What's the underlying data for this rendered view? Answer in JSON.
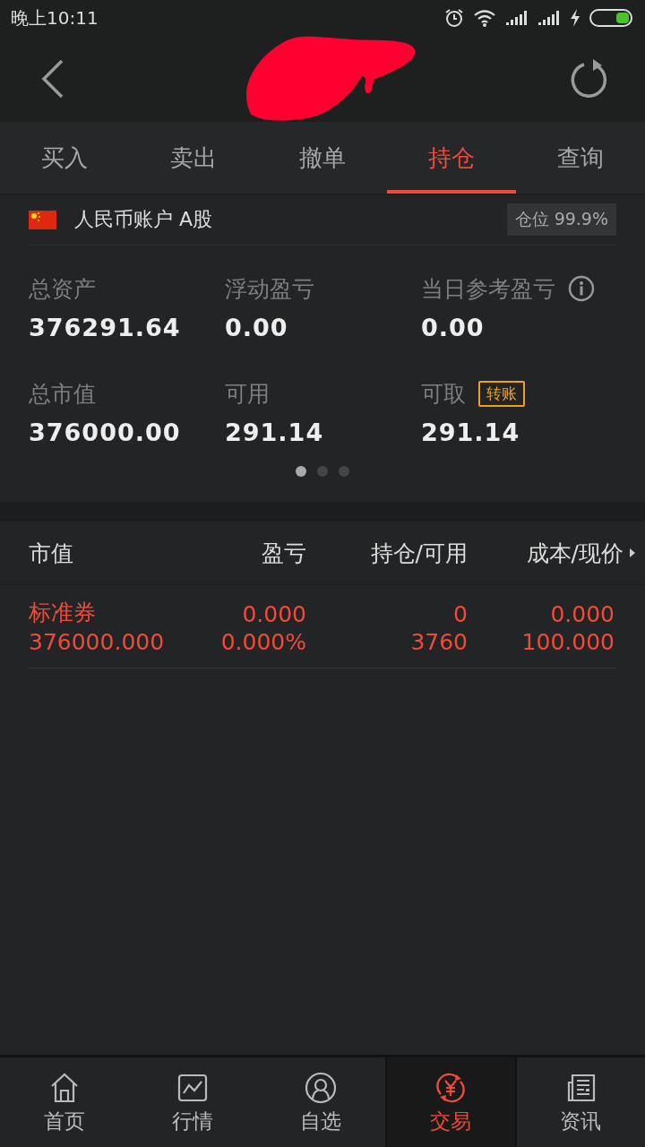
{
  "status_bar": {
    "time": "晚上10:11"
  },
  "tabs": [
    {
      "label": "买入",
      "selected": false
    },
    {
      "label": "卖出",
      "selected": false
    },
    {
      "label": "撤单",
      "selected": false
    },
    {
      "label": "持仓",
      "selected": true
    },
    {
      "label": "查询",
      "selected": false
    }
  ],
  "account": {
    "name": "人民币账户 A股",
    "position_badge": "仓位 99.9%"
  },
  "stats": [
    {
      "label": "总资产",
      "value": "376291.64"
    },
    {
      "label": "浮动盈亏",
      "value": "0.00"
    },
    {
      "label": "当日参考盈亏",
      "value": "0.00",
      "kind": "info"
    },
    {
      "label": "总市值",
      "value": "376000.00"
    },
    {
      "label": "可用",
      "value": "291.14"
    },
    {
      "label": "可取",
      "value": "291.14",
      "kind": "transfer",
      "action": "转账"
    }
  ],
  "pager": [
    {
      "selected": true
    },
    {
      "selected": false
    },
    {
      "selected": false
    }
  ],
  "table": {
    "columns": [
      "市值",
      "盈亏",
      "持仓/可用",
      "成本/现价"
    ],
    "rows": [
      {
        "cells": [
          [
            "标准券",
            "376000.000"
          ],
          [
            "0.000",
            "0.000%"
          ],
          [
            "0",
            "3760"
          ],
          [
            "0.000",
            "100.000"
          ]
        ]
      }
    ]
  },
  "bottom_nav": [
    {
      "label": "首页",
      "kind": "home",
      "selected": false
    },
    {
      "label": "行情",
      "kind": "chart",
      "selected": false
    },
    {
      "label": "自选",
      "kind": "user",
      "selected": false
    },
    {
      "label": "交易",
      "kind": "trade",
      "selected": true
    },
    {
      "label": "资讯",
      "kind": "news",
      "selected": false
    }
  ]
}
